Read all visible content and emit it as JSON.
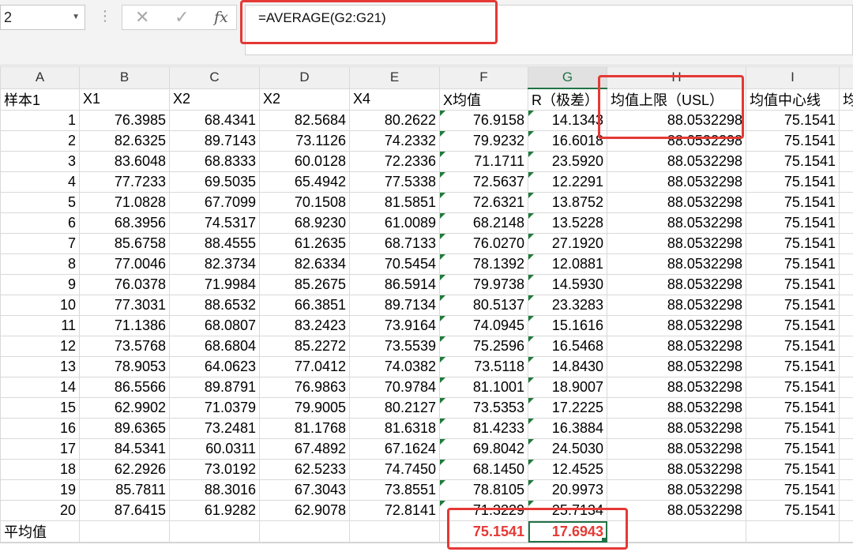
{
  "formula_bar": {
    "name_box": "2",
    "cancel_icon": "close-icon",
    "enter_icon": "check-icon",
    "fx_label": "fx",
    "formula": "=AVERAGE(G2:G21)"
  },
  "columns": [
    "A",
    "B",
    "C",
    "D",
    "E",
    "F",
    "G",
    "H",
    "I",
    ""
  ],
  "header_row": [
    "样本1",
    "X1",
    "X2",
    "X2",
    "X4",
    "X均值",
    "R（极差）",
    "均值上限（USL）",
    "均值中心线",
    "均"
  ],
  "rows": [
    [
      "1",
      "76.3985",
      "68.4341",
      "82.5684",
      "80.2622",
      "76.9158",
      "14.1343",
      "88.0532298",
      "75.1541"
    ],
    [
      "2",
      "82.6325",
      "89.7143",
      "73.1126",
      "74.2332",
      "79.9232",
      "16.6018",
      "88.0532298",
      "75.1541"
    ],
    [
      "3",
      "83.6048",
      "68.8333",
      "60.0128",
      "72.2336",
      "71.1711",
      "23.5920",
      "88.0532298",
      "75.1541"
    ],
    [
      "4",
      "77.7233",
      "69.5035",
      "65.4942",
      "77.5338",
      "72.5637",
      "12.2291",
      "88.0532298",
      "75.1541"
    ],
    [
      "5",
      "71.0828",
      "67.7099",
      "70.1508",
      "81.5851",
      "72.6321",
      "13.8752",
      "88.0532298",
      "75.1541"
    ],
    [
      "6",
      "68.3956",
      "74.5317",
      "68.9230",
      "61.0089",
      "68.2148",
      "13.5228",
      "88.0532298",
      "75.1541"
    ],
    [
      "7",
      "85.6758",
      "88.4555",
      "61.2635",
      "68.7133",
      "76.0270",
      "27.1920",
      "88.0532298",
      "75.1541"
    ],
    [
      "8",
      "77.0046",
      "82.3734",
      "82.6334",
      "70.5454",
      "78.1392",
      "12.0881",
      "88.0532298",
      "75.1541"
    ],
    [
      "9",
      "76.0378",
      "71.9984",
      "85.2675",
      "86.5914",
      "79.9738",
      "14.5930",
      "88.0532298",
      "75.1541"
    ],
    [
      "10",
      "77.3031",
      "88.6532",
      "66.3851",
      "89.7134",
      "80.5137",
      "23.3283",
      "88.0532298",
      "75.1541"
    ],
    [
      "11",
      "71.1386",
      "68.0807",
      "83.2423",
      "73.9164",
      "74.0945",
      "15.1616",
      "88.0532298",
      "75.1541"
    ],
    [
      "12",
      "73.5768",
      "68.6804",
      "85.2272",
      "73.5539",
      "75.2596",
      "16.5468",
      "88.0532298",
      "75.1541"
    ],
    [
      "13",
      "78.9053",
      "64.0623",
      "77.0412",
      "74.0382",
      "73.5118",
      "14.8430",
      "88.0532298",
      "75.1541"
    ],
    [
      "14",
      "86.5566",
      "89.8791",
      "76.9863",
      "70.9784",
      "81.1001",
      "18.9007",
      "88.0532298",
      "75.1541"
    ],
    [
      "15",
      "62.9902",
      "71.0379",
      "79.9005",
      "80.2127",
      "73.5353",
      "17.2225",
      "88.0532298",
      "75.1541"
    ],
    [
      "16",
      "89.6365",
      "73.2481",
      "81.1768",
      "81.6318",
      "81.4233",
      "16.3884",
      "88.0532298",
      "75.1541"
    ],
    [
      "17",
      "84.5341",
      "60.0311",
      "67.4892",
      "67.1624",
      "69.8042",
      "24.5030",
      "88.0532298",
      "75.1541"
    ],
    [
      "18",
      "62.2926",
      "73.0192",
      "62.5233",
      "74.7450",
      "68.1450",
      "12.4525",
      "88.0532298",
      "75.1541"
    ],
    [
      "19",
      "85.7811",
      "88.3016",
      "67.3043",
      "73.8551",
      "78.8105",
      "20.9973",
      "88.0532298",
      "75.1541"
    ],
    [
      "20",
      "87.6415",
      "61.9282",
      "62.9078",
      "72.8141",
      "71.3229",
      "25.7134",
      "88.0532298",
      "75.1541"
    ]
  ],
  "average_row": {
    "label": "平均值",
    "x_mean": "75.1541",
    "r_mean": "17.6943"
  },
  "colors": {
    "highlight_box": "#e53935",
    "average_text": "#e53935",
    "excel_green": "#217346",
    "error_triangle": "#1e7b3a"
  }
}
